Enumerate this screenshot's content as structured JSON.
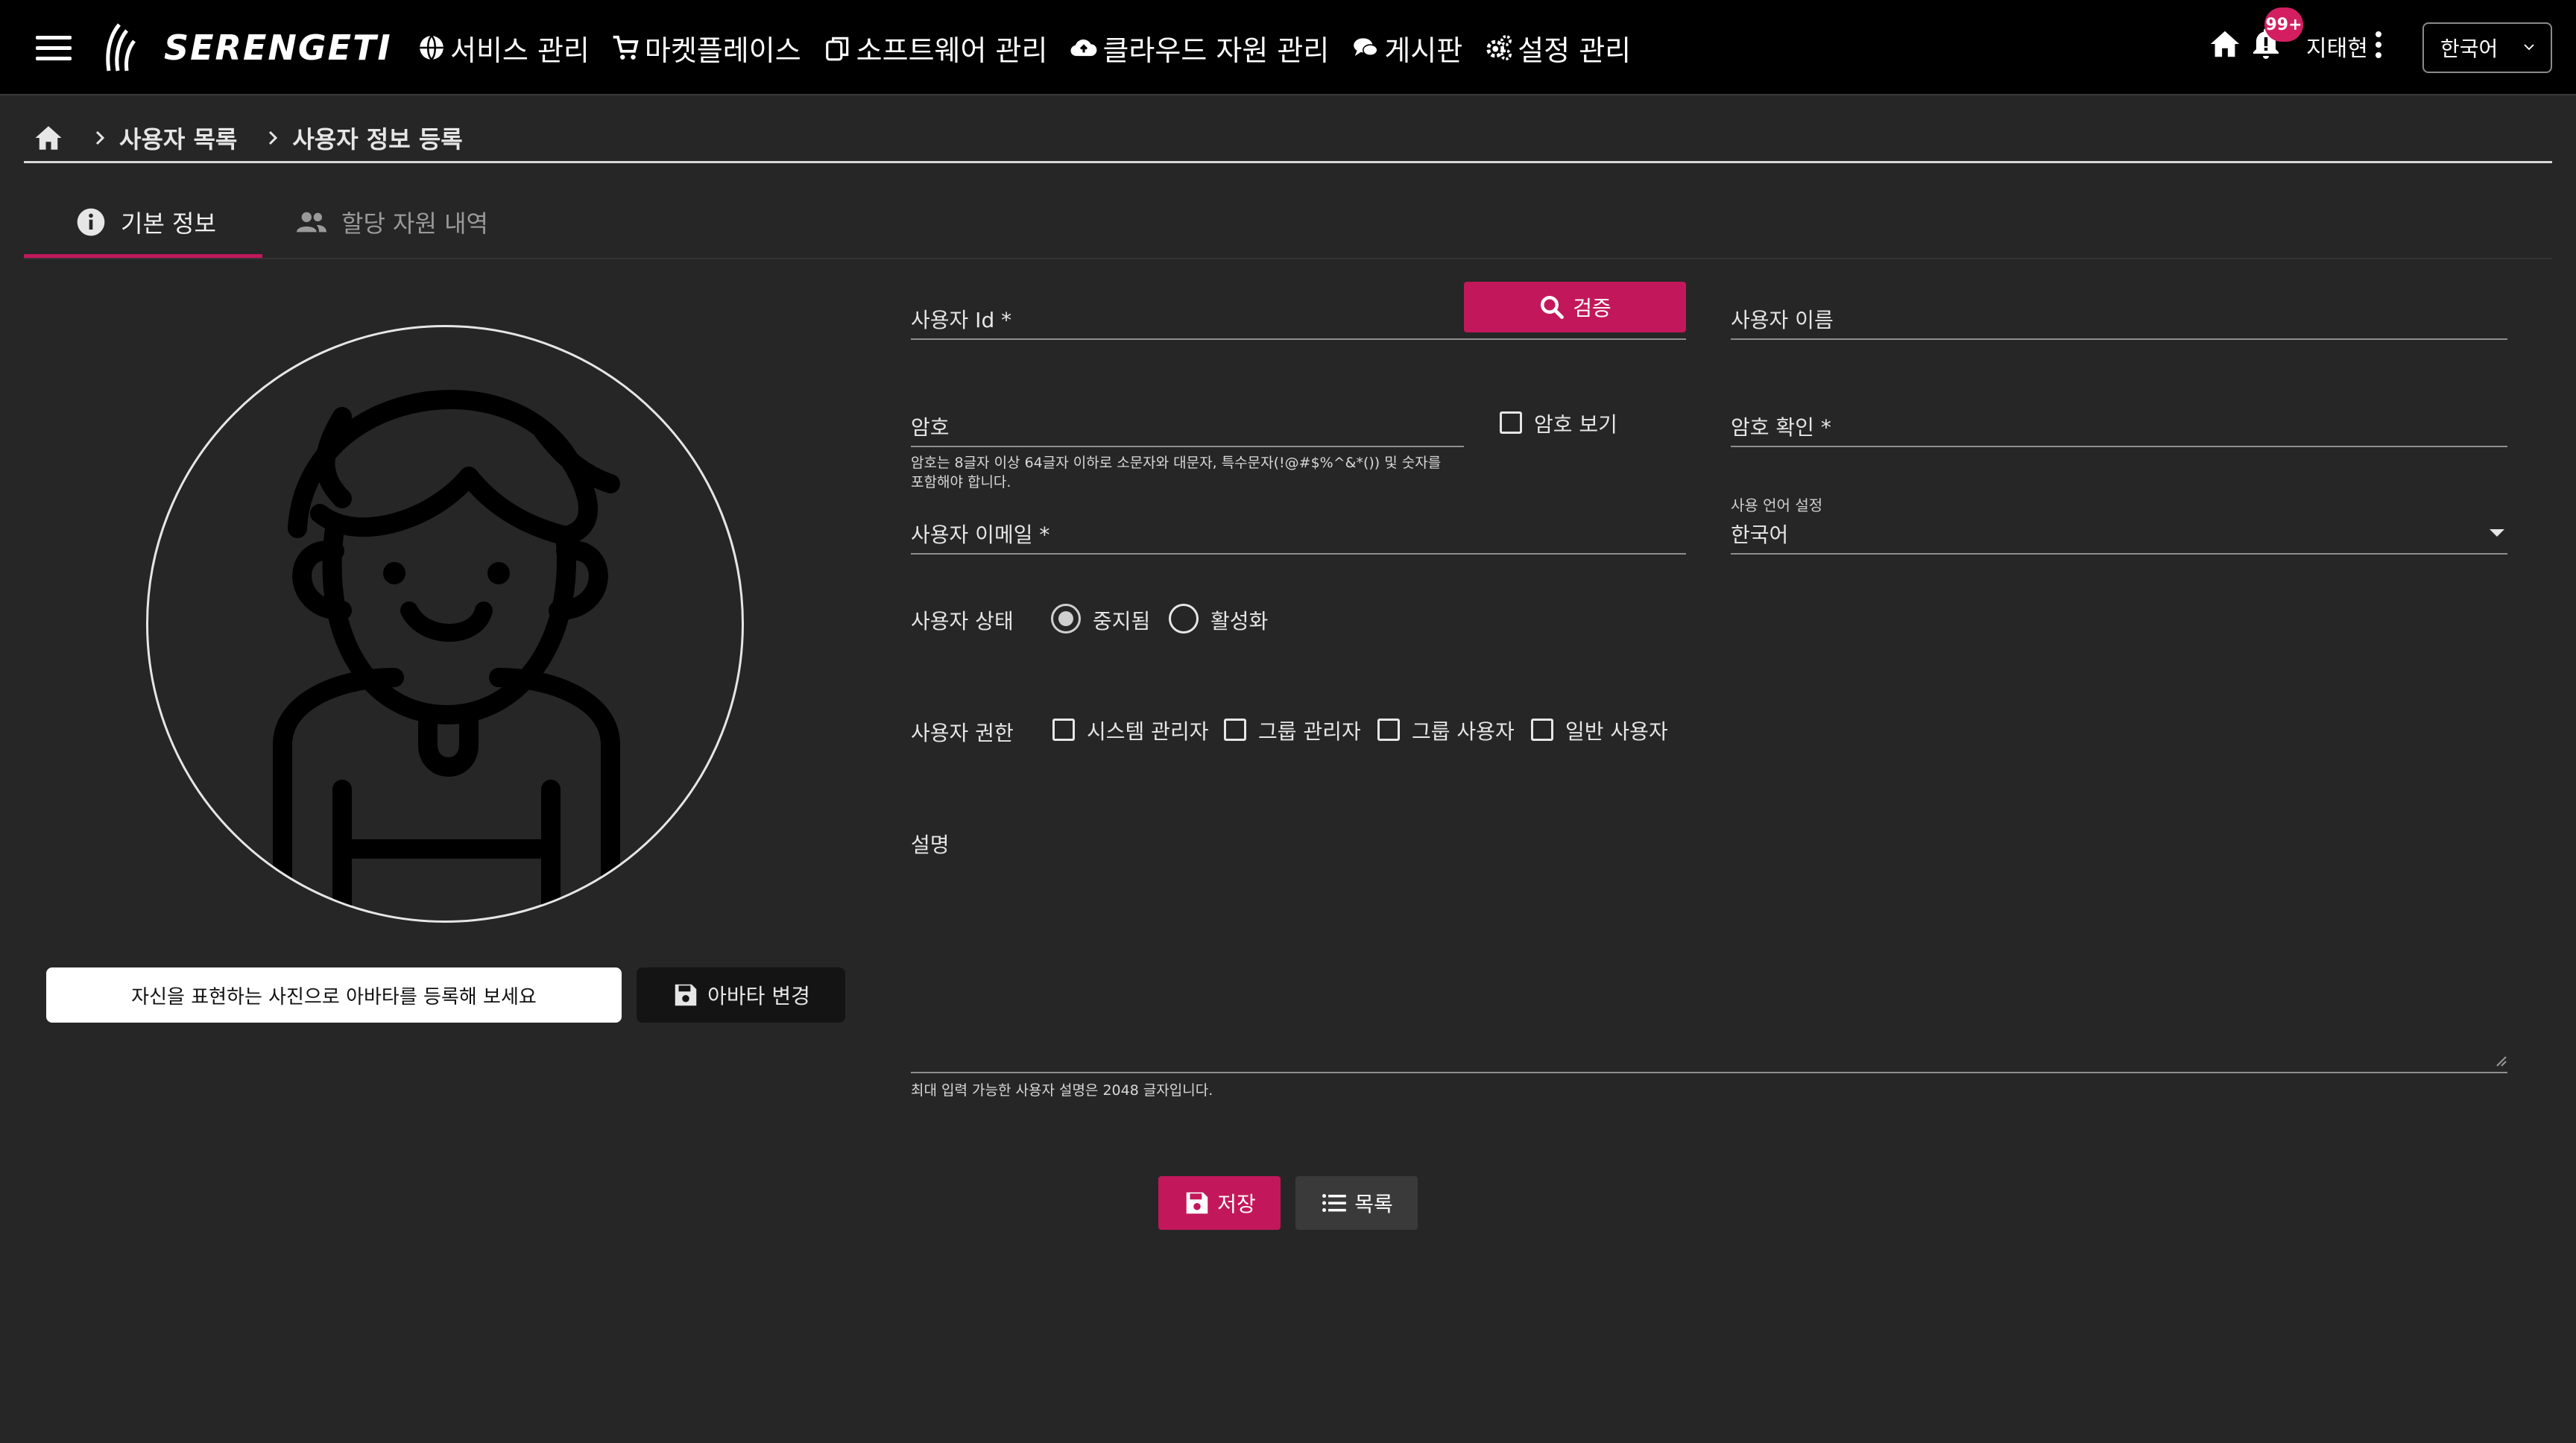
{
  "header": {
    "logo_text": "SERENGETI",
    "nav": [
      {
        "label": "서비스 관리",
        "icon": "globe-icon"
      },
      {
        "label": "마켓플레이스",
        "icon": "cart-icon"
      },
      {
        "label": "소프트웨어 관리",
        "icon": "software-icon"
      },
      {
        "label": "클라우드 자원 관리",
        "icon": "cloud-icon"
      },
      {
        "label": "게시판",
        "icon": "chat-icon"
      },
      {
        "label": "설정 관리",
        "icon": "gears-icon"
      }
    ],
    "notification_count": "99+",
    "username": "지태현",
    "language": "한국어"
  },
  "breadcrumb": {
    "items": [
      "사용자 목록",
      "사용자 정보 등록"
    ]
  },
  "tabs": [
    {
      "label": "기본 정보",
      "active": true
    },
    {
      "label": "할당 자원 내역",
      "active": false
    }
  ],
  "avatar": {
    "message": "자신을 표현하는 사진으로 아바타를 등록해 보세요",
    "change_button": "아바타 변경"
  },
  "form": {
    "user_id_label": "사용자 Id *",
    "verify_button": "검증",
    "user_name_label": "사용자 이름",
    "password_label": "암호",
    "show_password_label": "암호 보기",
    "password_confirm_label": "암호 확인 *",
    "password_hint_line1": "암호는 8글자 이상 64글자 이하로 소문자와 대문자, 특수문자(!@#$%^&*()) 및 숫자를",
    "password_hint_line2": "포함해야 합니다.",
    "email_label": "사용자 이메일 *",
    "language_setting_label": "사용 언어 설정",
    "language_value": "한국어",
    "status_label": "사용자 상태",
    "status_options": [
      "중지됨",
      "활성화"
    ],
    "status_selected": "중지됨",
    "role_label": "사용자 권한",
    "role_options": [
      "시스템 관리자",
      "그룹 관리자",
      "그룹 사용자",
      "일반 사용자"
    ],
    "description_label": "설명",
    "description_hint": "최대 입력 가능한 사용자 설명은 2048 글자입니다."
  },
  "actions": {
    "save": "저장",
    "list": "목록"
  },
  "colors": {
    "accent": "#c2185b",
    "background": "#262626",
    "topbar": "#000000"
  }
}
